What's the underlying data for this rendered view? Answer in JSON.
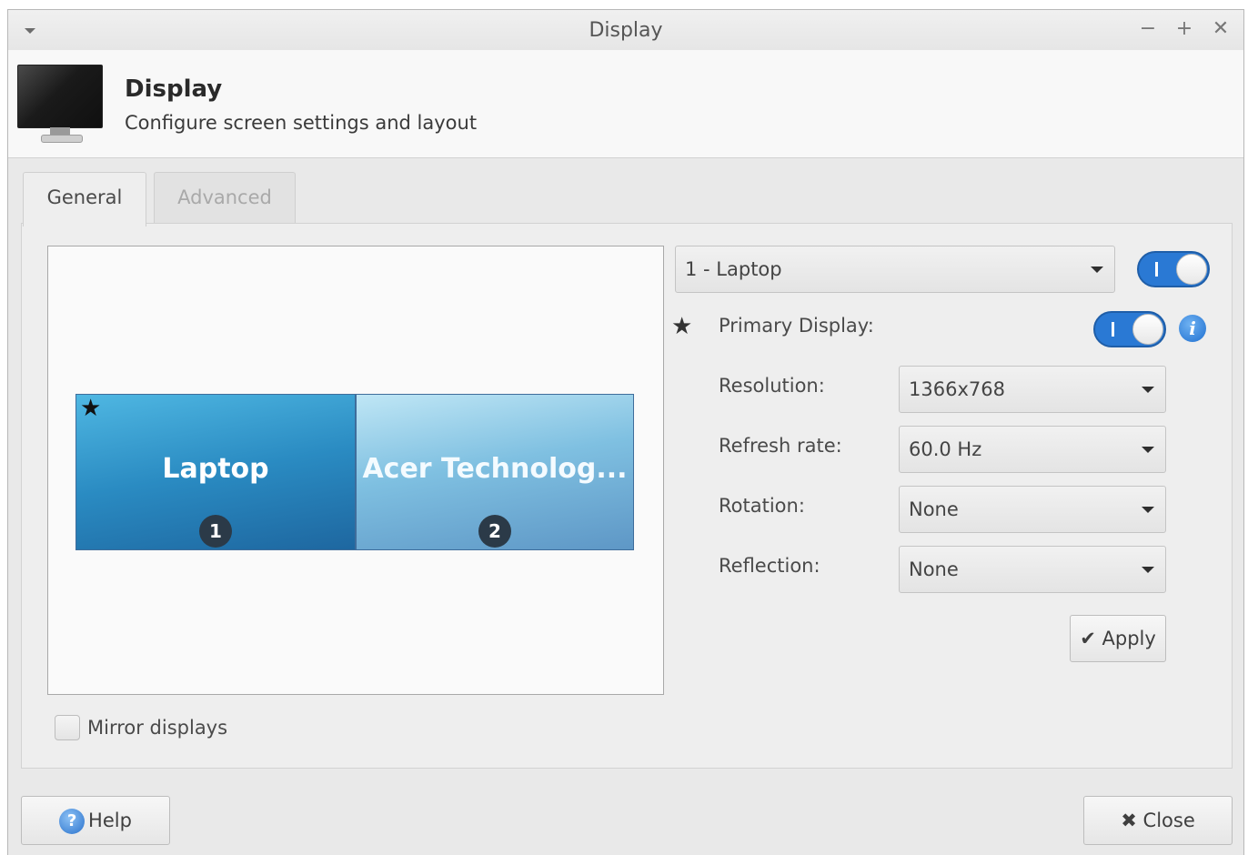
{
  "window": {
    "title": "Display"
  },
  "header": {
    "title": "Display",
    "subtitle": "Configure screen settings and layout"
  },
  "tabs": [
    {
      "label": "General"
    },
    {
      "label": "Advanced"
    }
  ],
  "preview": {
    "displays": [
      {
        "name": "Laptop",
        "number": "1"
      },
      {
        "name": "Acer Technolog...",
        "number": "2"
      }
    ]
  },
  "settings": {
    "display_select": "1 - Laptop",
    "primary_label": "Primary Display:",
    "resolution_label": "Resolution:",
    "resolution_value": "1366x768",
    "refresh_label": "Refresh rate:",
    "refresh_value": "60.0 Hz",
    "rotation_label": "Rotation:",
    "rotation_value": "None",
    "reflection_label": "Reflection:",
    "reflection_value": "None",
    "apply_label": "Apply"
  },
  "mirror_label": "Mirror displays",
  "footer": {
    "help_label": "Help",
    "close_label": "Close"
  },
  "colors": {
    "accent": "#2a79d4",
    "display_active": "#2a8bc2",
    "display_inactive": "#7fc0e1"
  }
}
